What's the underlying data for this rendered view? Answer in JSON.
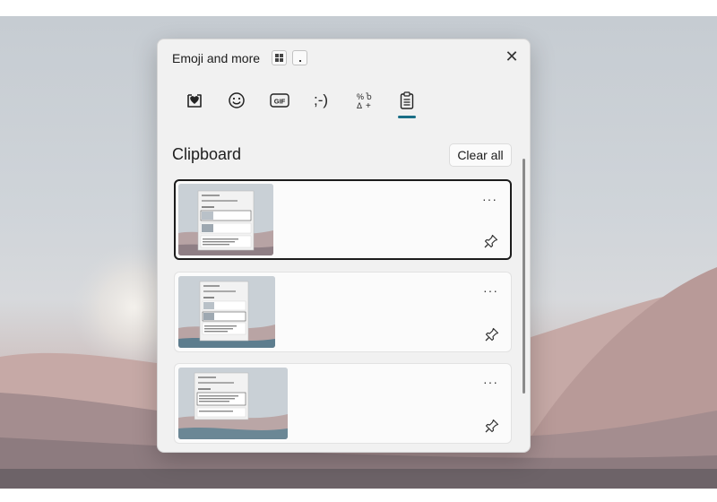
{
  "window": {
    "title": "Emoji and more"
  },
  "shortcut_hint": {
    "key_icon": "windows-key-icon",
    "key_dot": "."
  },
  "close_icon": "close-icon",
  "categories": [
    {
      "name": "favorites",
      "icon": "heart-icon"
    },
    {
      "name": "emoji",
      "icon": "smiley-icon"
    },
    {
      "name": "gif",
      "icon": "gif-icon",
      "label": "GIF"
    },
    {
      "name": "kaomoji",
      "icon": "kaomoji-icon",
      "label": ";-)"
    },
    {
      "name": "symbols",
      "icon": "symbols-icon"
    },
    {
      "name": "clipboard",
      "icon": "clipboard-icon",
      "selected": true
    }
  ],
  "clipboard": {
    "title": "Clipboard",
    "clear_all": "Clear all",
    "items": [
      {
        "type": "image",
        "selected": true,
        "more_label": "···",
        "pin_icon": "pin-icon"
      },
      {
        "type": "image",
        "selected": false,
        "more_label": "···",
        "pin_icon": "pin-icon"
      },
      {
        "type": "image",
        "selected": false,
        "more_label": "···",
        "pin_icon": "pin-icon"
      }
    ]
  },
  "colors": {
    "accent": "#1a6e86",
    "panel": "#f1f1f1",
    "card": "#fbfbfb"
  }
}
